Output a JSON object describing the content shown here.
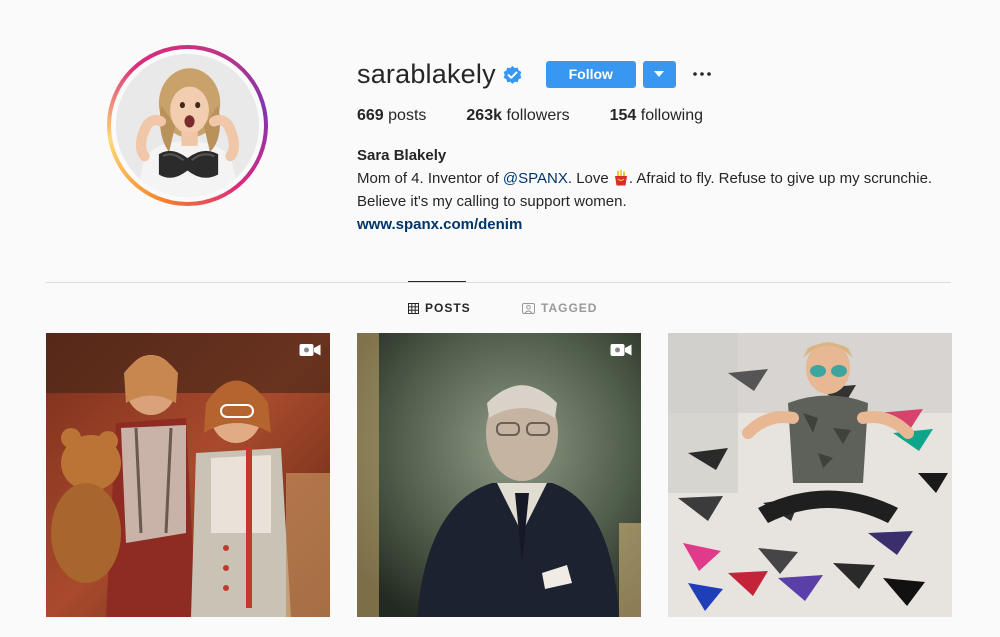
{
  "profile": {
    "username": "sarablakely",
    "verified": true,
    "follow_label": "Follow",
    "posts_count": "669",
    "posts_label": "posts",
    "followers_count": "263k",
    "followers_label": "followers",
    "following_count": "154",
    "following_label": "following",
    "full_name": "Sara Blakely",
    "bio_part1": "Mom of 4. Inventor of ",
    "bio_mention": "@SPANX",
    "bio_part2": ". Love ",
    "bio_part3": ". Afraid to fly. Refuse to give up my scrunchie.",
    "bio_line2": "Believe it's my calling to support women.",
    "website": "www.spanx.com/denim"
  },
  "tabs": [
    {
      "label": "POSTS",
      "icon": "grid-icon",
      "active": true
    },
    {
      "label": "TAGGED",
      "icon": "tagged-icon",
      "active": false
    }
  ],
  "posts": [
    {
      "type": "video",
      "description_icon": "video-icon"
    },
    {
      "type": "video",
      "description_icon": "video-icon"
    },
    {
      "type": "photo",
      "description_icon": ""
    }
  ],
  "colors": {
    "accent": "#3897f0",
    "link": "#003569",
    "verified": "#3897f0"
  }
}
